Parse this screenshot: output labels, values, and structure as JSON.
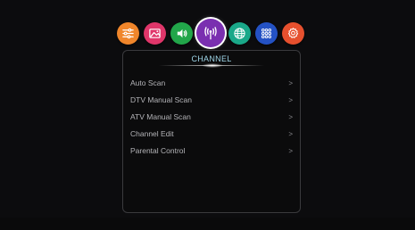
{
  "categories": [
    {
      "name": "picture",
      "icon": "sliders-icon",
      "color": "#f0862b"
    },
    {
      "name": "image",
      "icon": "image-icon",
      "color": "#e0366a"
    },
    {
      "name": "sound",
      "icon": "speaker-icon",
      "color": "#22a64a"
    },
    {
      "name": "channel",
      "icon": "antenna-icon",
      "color": "#7a2fb0",
      "selected": true
    },
    {
      "name": "network",
      "icon": "globe-icon",
      "color": "#1aa889"
    },
    {
      "name": "apps",
      "icon": "grid-icon",
      "color": "#2452c4"
    },
    {
      "name": "settings",
      "icon": "gear-icon",
      "color": "#e6502e"
    }
  ],
  "panel": {
    "title": "CHANNEL",
    "items": [
      {
        "label": "Auto Scan",
        "chevron": ">"
      },
      {
        "label": "DTV Manual Scan",
        "chevron": ">"
      },
      {
        "label": "ATV Manual Scan",
        "chevron": ">"
      },
      {
        "label": "Channel Edit",
        "chevron": ">"
      },
      {
        "label": "Parental Control",
        "chevron": ">"
      }
    ]
  }
}
